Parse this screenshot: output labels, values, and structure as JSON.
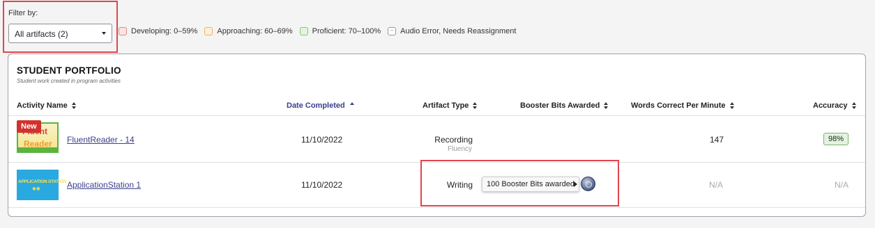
{
  "filter": {
    "label": "Filter by:",
    "selected": "All artifacts (2)"
  },
  "legend": [
    {
      "label": "Developing: 0–59%",
      "color": "#fbe3e3"
    },
    {
      "label": "Approaching: 60–69%",
      "color": "#fdf0d8"
    },
    {
      "label": "Proficient: 70–100%",
      "color": "#e3f3de"
    },
    {
      "label": "Audio Error, Needs Reassignment",
      "symbol": "--"
    }
  ],
  "portfolio": {
    "title": "STUDENT PORTFOLIO",
    "subtitle": "Student work created in program activities",
    "columns": {
      "activity": "Activity Name",
      "date": "Date Completed",
      "type": "Artifact Type",
      "bits": "Booster Bits Awarded",
      "wcpm": "Words Correct Per Minute",
      "accuracy": "Accuracy"
    },
    "rows": [
      {
        "badge": "New",
        "thumb_line1": "Fluent",
        "thumb_line2": "Reader",
        "activity": "FluentReader - 14",
        "date": "11/10/2022",
        "type": "Recording",
        "type_sub": "Fluency",
        "wcpm": "147",
        "accuracy": "98%"
      },
      {
        "thumb_line1": "APPLICATION STATION",
        "thumb_line2": "✺✺",
        "activity": "ApplicationStation 1",
        "date": "11/10/2022",
        "type": "Writing",
        "bits_tooltip": "100 Booster Bits awarded",
        "wcpm": "N/A",
        "accuracy": "N/A"
      }
    ]
  },
  "colors": {
    "highlight": "#e0454e",
    "link": "#3c3f8c",
    "new_badge": "#d1322e"
  }
}
